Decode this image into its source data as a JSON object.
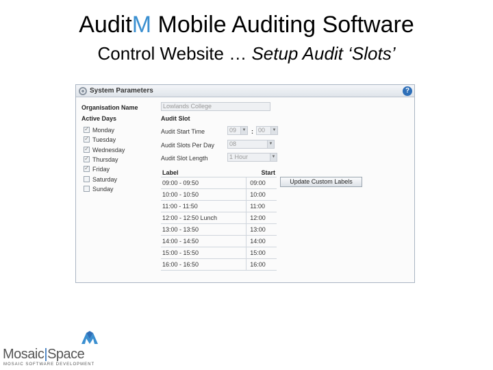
{
  "slide": {
    "title_pre": "Audit",
    "title_accent": "M",
    "title_post": " Mobile Auditing Software",
    "subtitle_plain": "Control Website … ",
    "subtitle_italic": "Setup Audit ‘Slots’"
  },
  "panel": {
    "title": "System Parameters",
    "help_icon": "?",
    "organisation_label": "Organisation Name",
    "organisation_value": "Lowlands College",
    "active_days_label": "Active Days",
    "days": [
      {
        "label": "Monday",
        "checked": true
      },
      {
        "label": "Tuesday",
        "checked": true
      },
      {
        "label": "Wednesday",
        "checked": true
      },
      {
        "label": "Thursday",
        "checked": true
      },
      {
        "label": "Friday",
        "checked": true
      },
      {
        "label": "Saturday",
        "checked": false
      },
      {
        "label": "Sunday",
        "checked": false
      }
    ],
    "audit_slot_label": "Audit Slot",
    "start_time_label": "Audit Start Time",
    "start_hour": "09",
    "time_separator": ":",
    "start_minute": "00",
    "slots_per_day_label": "Audit Slots Per Day",
    "slots_per_day": "08",
    "slot_length_label": "Audit Slot Length",
    "slot_length": "1 Hour",
    "table": {
      "headers": {
        "label": "Label",
        "start": "Start"
      },
      "rows": [
        {
          "label": "09:00 - 09:50",
          "start": "09:00"
        },
        {
          "label": "10:00 - 10:50",
          "start": "10:00"
        },
        {
          "label": "11:00 - 11:50",
          "start": "11:00"
        },
        {
          "label": "12:00 - 12:50 Lunch",
          "start": "12:00"
        },
        {
          "label": "13:00 - 13:50",
          "start": "13:00"
        },
        {
          "label": "14:00 - 14:50",
          "start": "14:00"
        },
        {
          "label": "15:00 - 15:50",
          "start": "15:00"
        },
        {
          "label": "16:00 - 16:50",
          "start": "16:00"
        }
      ]
    },
    "update_button": "Update Custom Labels"
  },
  "logo": {
    "left": "Mosaic",
    "separator": "|",
    "right": "Space",
    "tagline": "MOSAIC SOFTWARE DEVELOPMENT"
  },
  "colors": {
    "accent": "#3a8fd0",
    "help_blue": "#2e6fb8"
  }
}
